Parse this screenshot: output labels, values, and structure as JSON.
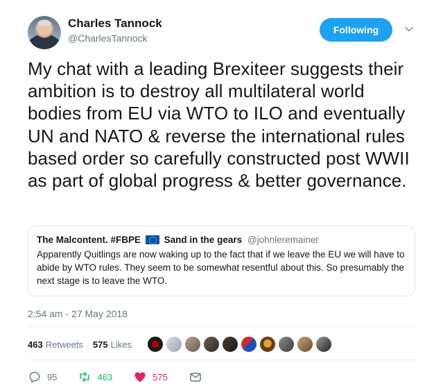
{
  "author": {
    "name": "Charles Tannock",
    "handle": "@CharlesTannock",
    "follow_label": "Following"
  },
  "tweet": {
    "text": "My chat with a leading Brexiteer suggests their ambition is to destroy all multilateral world bodies from EU via WTO to ILO and eventually UN and NATO & reverse the international rules based order so carefully constructed post WWII as part of global progress & better governance."
  },
  "quote": {
    "name": "The Malcontent. #FBPE",
    "name_suffix": "Sand in the gears",
    "handle": "@johnleremainer",
    "text": "Apparently Quitlings are now waking up to the fact that if we leave the EU we will have to abide by WTO rules. They seem to be somewhat resentful about this.  So presumably the next stage is to leave the WTO."
  },
  "timestamp": "2:54 am - 27 May 2018",
  "stats": {
    "retweets_count": "463",
    "retweets_label": "Retweets",
    "likes_count": "575",
    "likes_label": "Likes"
  },
  "actions": {
    "replies": "95",
    "retweets": "463",
    "likes": "575"
  },
  "colors": {
    "accent": "#1da1f2",
    "retweet": "#17bf63",
    "like": "#e0245e",
    "secondary_text": "#657786"
  },
  "likers_icon": "avatar-icon"
}
